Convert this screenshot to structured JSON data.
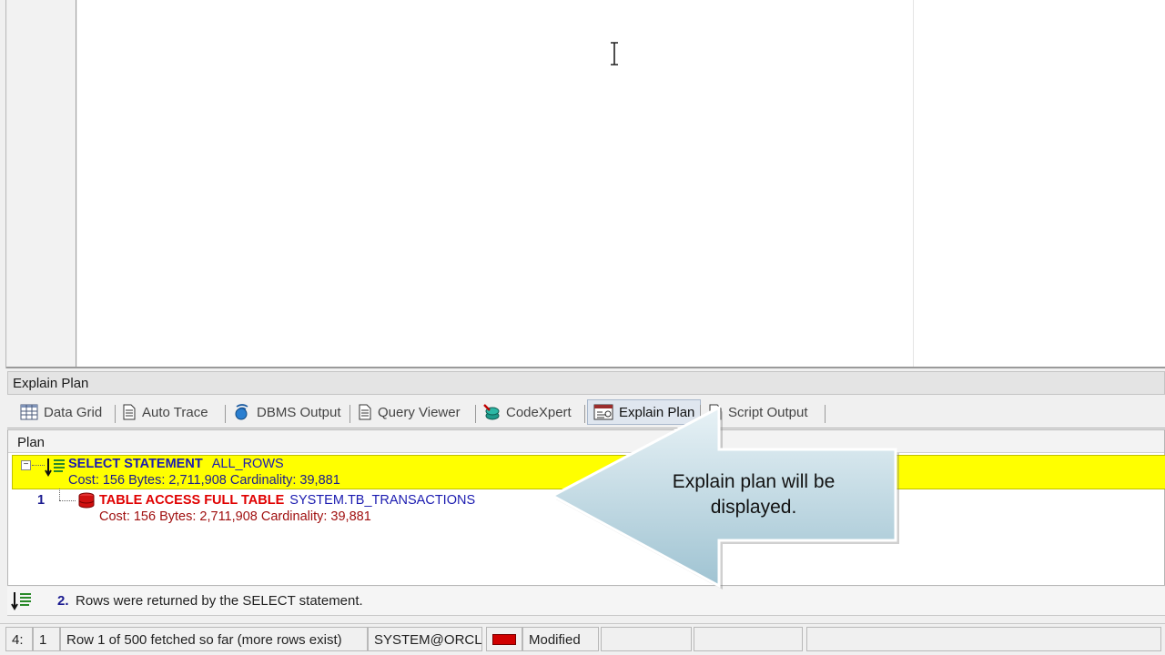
{
  "panel": {
    "title": "Explain Plan"
  },
  "tabs": [
    {
      "label": "Data Grid",
      "icon": "grid-icon",
      "active": false
    },
    {
      "label": "Auto Trace",
      "icon": "document-icon",
      "active": false
    },
    {
      "label": "DBMS Output",
      "icon": "dbms-output-icon",
      "active": false
    },
    {
      "label": "Query Viewer",
      "icon": "document-icon",
      "active": false
    },
    {
      "label": "CodeXpert",
      "icon": "codexpert-icon",
      "active": false
    },
    {
      "label": "Explain Plan",
      "icon": "explain-plan-icon",
      "active": true
    },
    {
      "label": "Script Output",
      "icon": "document-icon",
      "active": false
    }
  ],
  "plan": {
    "header": "Plan",
    "rows": [
      {
        "operation": "SELECT STATEMENT",
        "option": "ALL_ROWS",
        "details": "Cost: 156  Bytes: 2,711,908  Cardinality: 39,881"
      },
      {
        "number": "1",
        "operation": "TABLE ACCESS FULL TABLE",
        "object": "SYSTEM.TB_TRANSACTIONS",
        "details": "Cost: 156  Bytes: 2,711,908  Cardinality: 39,881"
      }
    ]
  },
  "message": {
    "number": "2.",
    "text": "Rows were returned by the SELECT statement."
  },
  "status": {
    "line": "4:",
    "col": "1",
    "fetch": "Row 1 of 500 fetched so far (more rows exist)",
    "connection": "SYSTEM@ORCL",
    "state": "Modified"
  },
  "callout": {
    "line1": "Explain plan will be",
    "line2": "displayed."
  },
  "colors": {
    "highlight": "#ffff00",
    "operation": "#1b1bb0",
    "access": "#e00000"
  }
}
